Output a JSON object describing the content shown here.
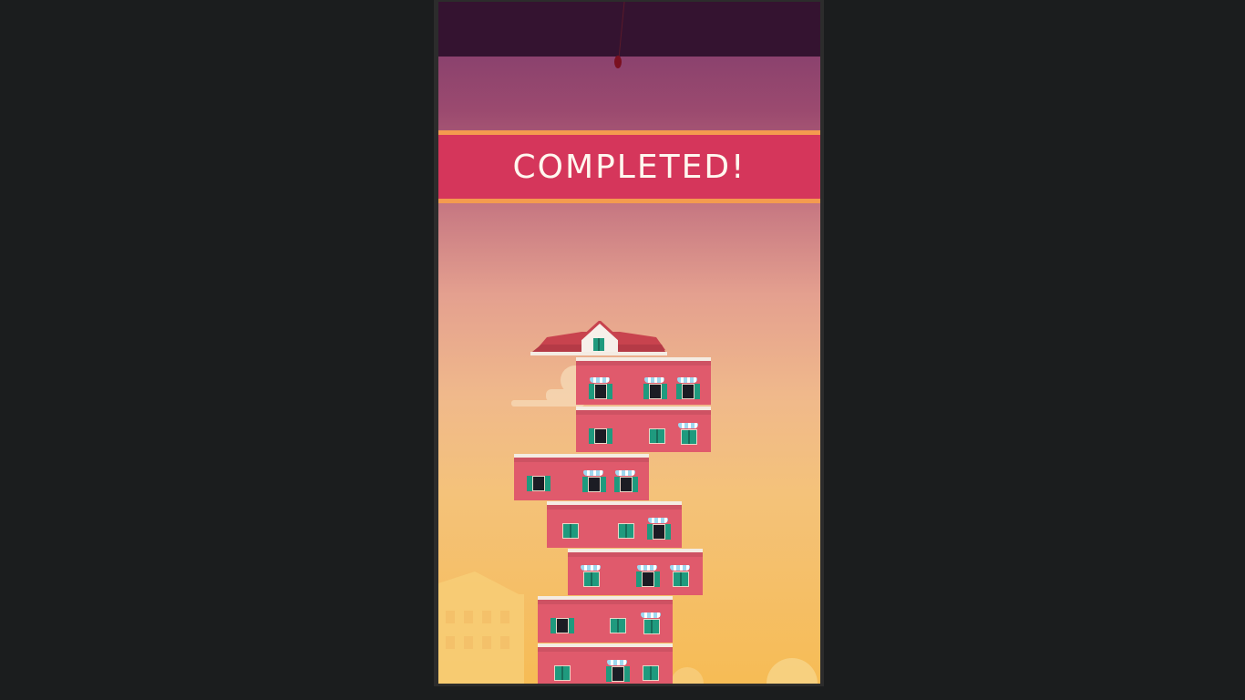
{
  "game": {
    "banner_text": "COMPLETED!",
    "tower": {
      "floor_count": 7,
      "has_roof": true
    },
    "colors": {
      "page_background": "#1b1d1e",
      "sky_top": "#341330",
      "banner": "#d5365b",
      "banner_trim": "#f49b4f",
      "building": "#e05a6c",
      "shutters": "#1f9a7e"
    }
  }
}
